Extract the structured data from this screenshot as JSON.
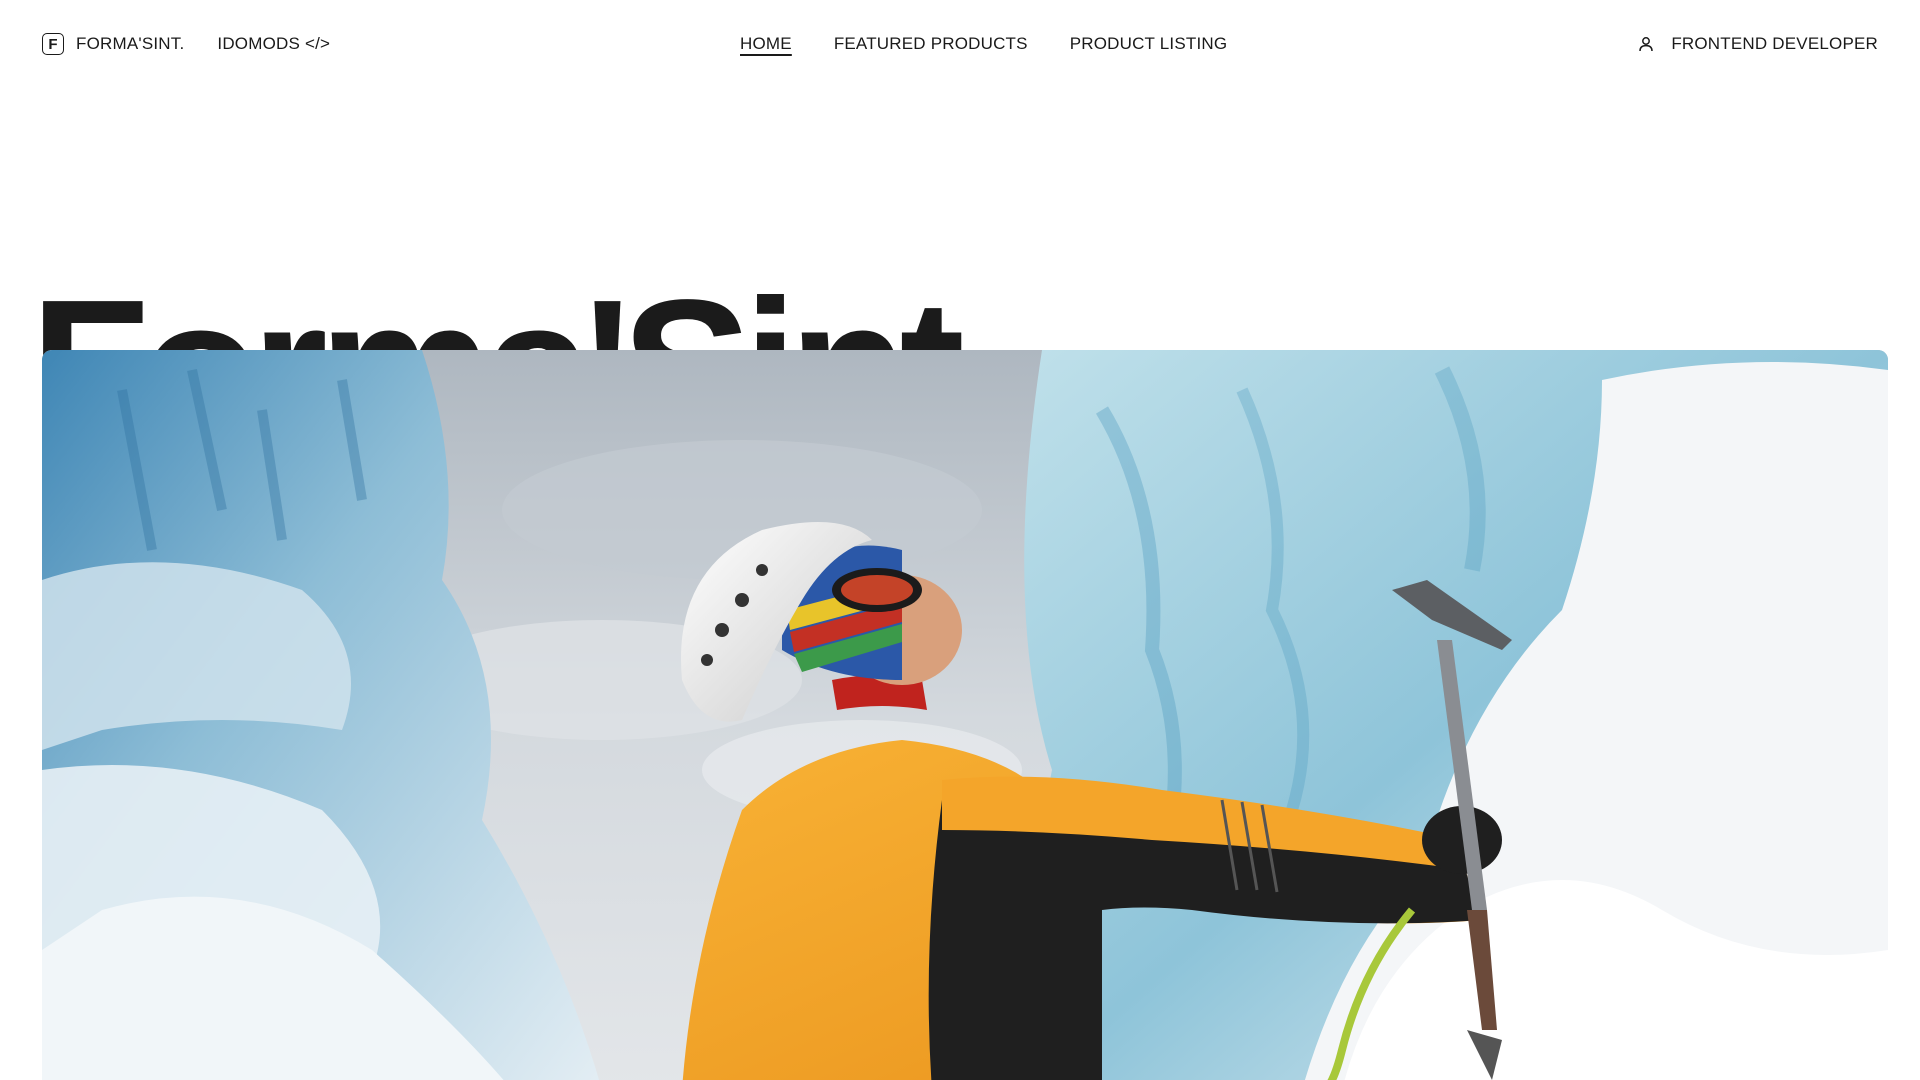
{
  "header": {
    "brand": {
      "logo_letter": "F",
      "name": "FORMA'SINT.",
      "icon": "brand-logo-icon"
    },
    "secondary_link": "IDOMODS </>",
    "nav": [
      {
        "label": "HOME",
        "active": true
      },
      {
        "label": "FEATURED PRODUCTS",
        "active": false
      },
      {
        "label": "PRODUCT LISTING",
        "active": false
      }
    ],
    "user": {
      "icon": "user-icon",
      "label": "FRONTEND DEVELOPER"
    }
  },
  "hero": {
    "title": "Forma'Sint.",
    "image": {
      "subject": "ice-climber-photo"
    }
  },
  "colors": {
    "text": "#1a1a1a",
    "background": "#ffffff",
    "jacket": "#f6a623",
    "ice": "#a9cfdf"
  }
}
